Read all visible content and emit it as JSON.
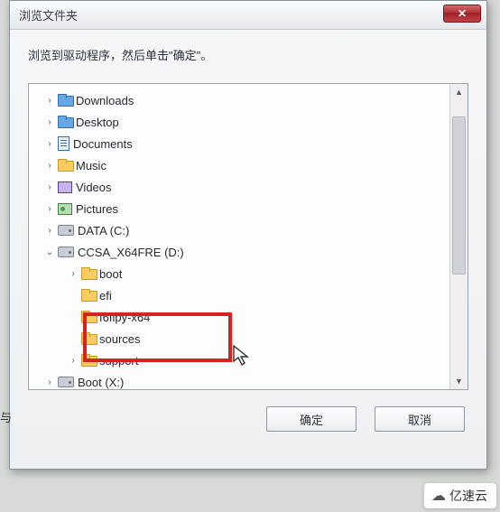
{
  "dialog": {
    "title": "浏览文件夹",
    "instruction": "浏览到驱动程序，然后单击\"确定\"。",
    "close_symbol": "✕"
  },
  "tree": {
    "items": [
      {
        "indent": 1,
        "toggle": ">",
        "icon": "folder-blue",
        "label": "Downloads"
      },
      {
        "indent": 1,
        "toggle": ">",
        "icon": "folder-blue",
        "label": "Desktop"
      },
      {
        "indent": 1,
        "toggle": ">",
        "icon": "doc",
        "label": "Documents"
      },
      {
        "indent": 1,
        "toggle": ">",
        "icon": "folder",
        "label": "Music"
      },
      {
        "indent": 1,
        "toggle": ">",
        "icon": "vid",
        "label": "Videos"
      },
      {
        "indent": 1,
        "toggle": ">",
        "icon": "pic",
        "label": "Pictures"
      },
      {
        "indent": 1,
        "toggle": ">",
        "icon": "drive",
        "label": "DATA (C:)"
      },
      {
        "indent": 1,
        "toggle": "v",
        "icon": "drive",
        "label": "CCSA_X64FRE (D:)"
      },
      {
        "indent": 2,
        "toggle": ">",
        "icon": "folder",
        "label": "boot"
      },
      {
        "indent": 2,
        "toggle": "",
        "icon": "folder",
        "label": "efi"
      },
      {
        "indent": 2,
        "toggle": "",
        "icon": "folder",
        "label": "f6flpy-x64",
        "highlight": true
      },
      {
        "indent": 2,
        "toggle": "",
        "icon": "folder",
        "label": "sources"
      },
      {
        "indent": 2,
        "toggle": ">",
        "icon": "folder",
        "label": "support"
      },
      {
        "indent": 1,
        "toggle": ">",
        "icon": "drive",
        "label": "Boot (X:)"
      }
    ]
  },
  "buttons": {
    "ok": "确定",
    "cancel": "取消"
  },
  "scrollbar": {
    "up": "▲",
    "down": "▼"
  },
  "watermark": "亿速云",
  "left_fragment": "与"
}
